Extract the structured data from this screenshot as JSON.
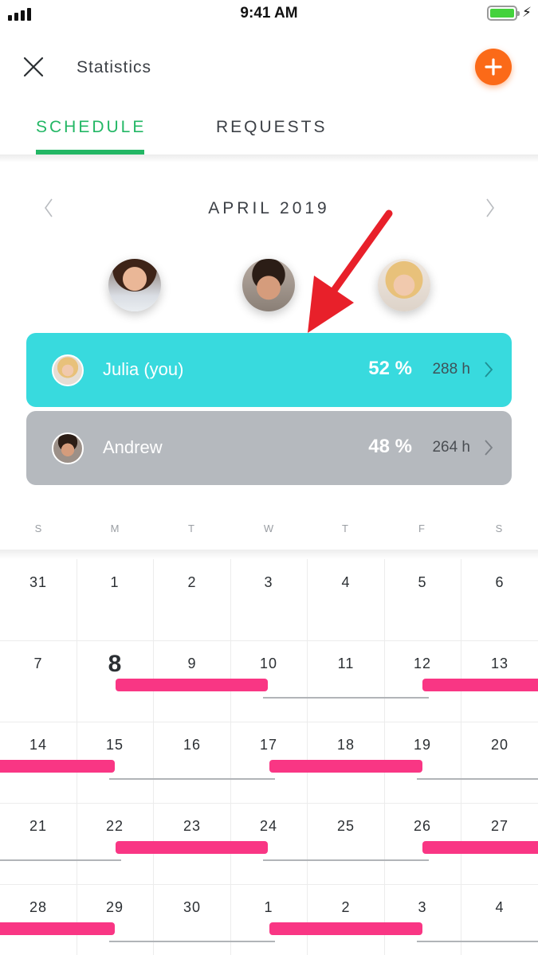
{
  "status_bar": {
    "time": "9:41 AM"
  },
  "header": {
    "title": "Statistics"
  },
  "tabs": [
    {
      "label": "SCHEDULE",
      "active": true
    },
    {
      "label": "REQUESTS",
      "active": false
    }
  ],
  "month": {
    "label": "APRIL 2019"
  },
  "people": [
    {
      "name": "Julia (you)",
      "percent": "52 %",
      "hours": "288 h",
      "color": "#38DADE"
    },
    {
      "name": "Andrew",
      "percent": "48 %",
      "hours": "264 h",
      "color": "#B5B9BE"
    }
  ],
  "weekdays": [
    "S",
    "M",
    "T",
    "W",
    "T",
    "F",
    "S"
  ],
  "calendar": {
    "today": "8",
    "weeks": [
      [
        "31",
        "1",
        "2",
        "3",
        "4",
        "5",
        "6"
      ],
      [
        "7",
        "8",
        "9",
        "10",
        "11",
        "12",
        "13"
      ],
      [
        "14",
        "15",
        "16",
        "17",
        "18",
        "19",
        "20"
      ],
      [
        "21",
        "22",
        "23",
        "24",
        "25",
        "26",
        "27"
      ],
      [
        "28",
        "29",
        "30",
        "1",
        "2",
        "3",
        "4"
      ]
    ]
  },
  "colors": {
    "accent_green": "#23B765",
    "add_button": "#FB6A18",
    "shift_pink": "#F93684",
    "annotation_red": "#E8202A"
  }
}
